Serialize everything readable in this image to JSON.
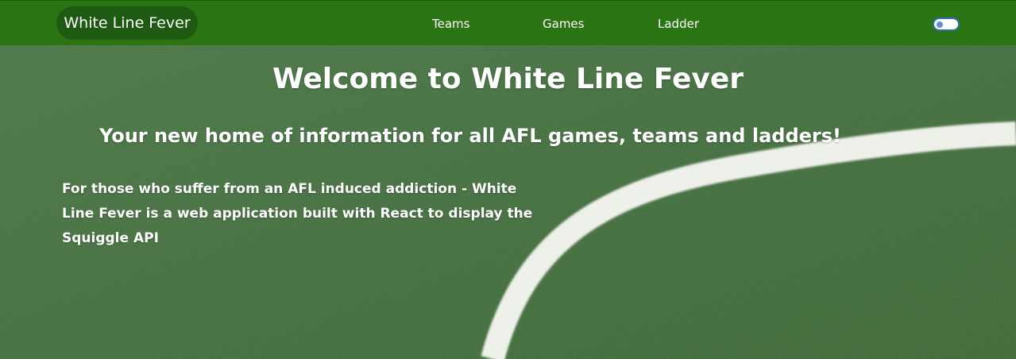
{
  "navbar": {
    "brand": "White Line Fever",
    "links": [
      "Teams",
      "Games",
      "Ladder"
    ],
    "theme_toggle": "theme-toggle"
  },
  "hero": {
    "title": "Welcome to White Line Fever",
    "subtitle": "Your new home of information for all AFL games, teams and ladders!",
    "description": "For those who suffer from an AFL induced addiction - White Line Fever is a web application built with React to display the Squiggle API"
  },
  "colors": {
    "navbar": "#2b7414",
    "brand_pill": "#1f5a12",
    "turf": "#3f6b3a",
    "line": "#f0f2ec",
    "text": "#ffffff"
  }
}
